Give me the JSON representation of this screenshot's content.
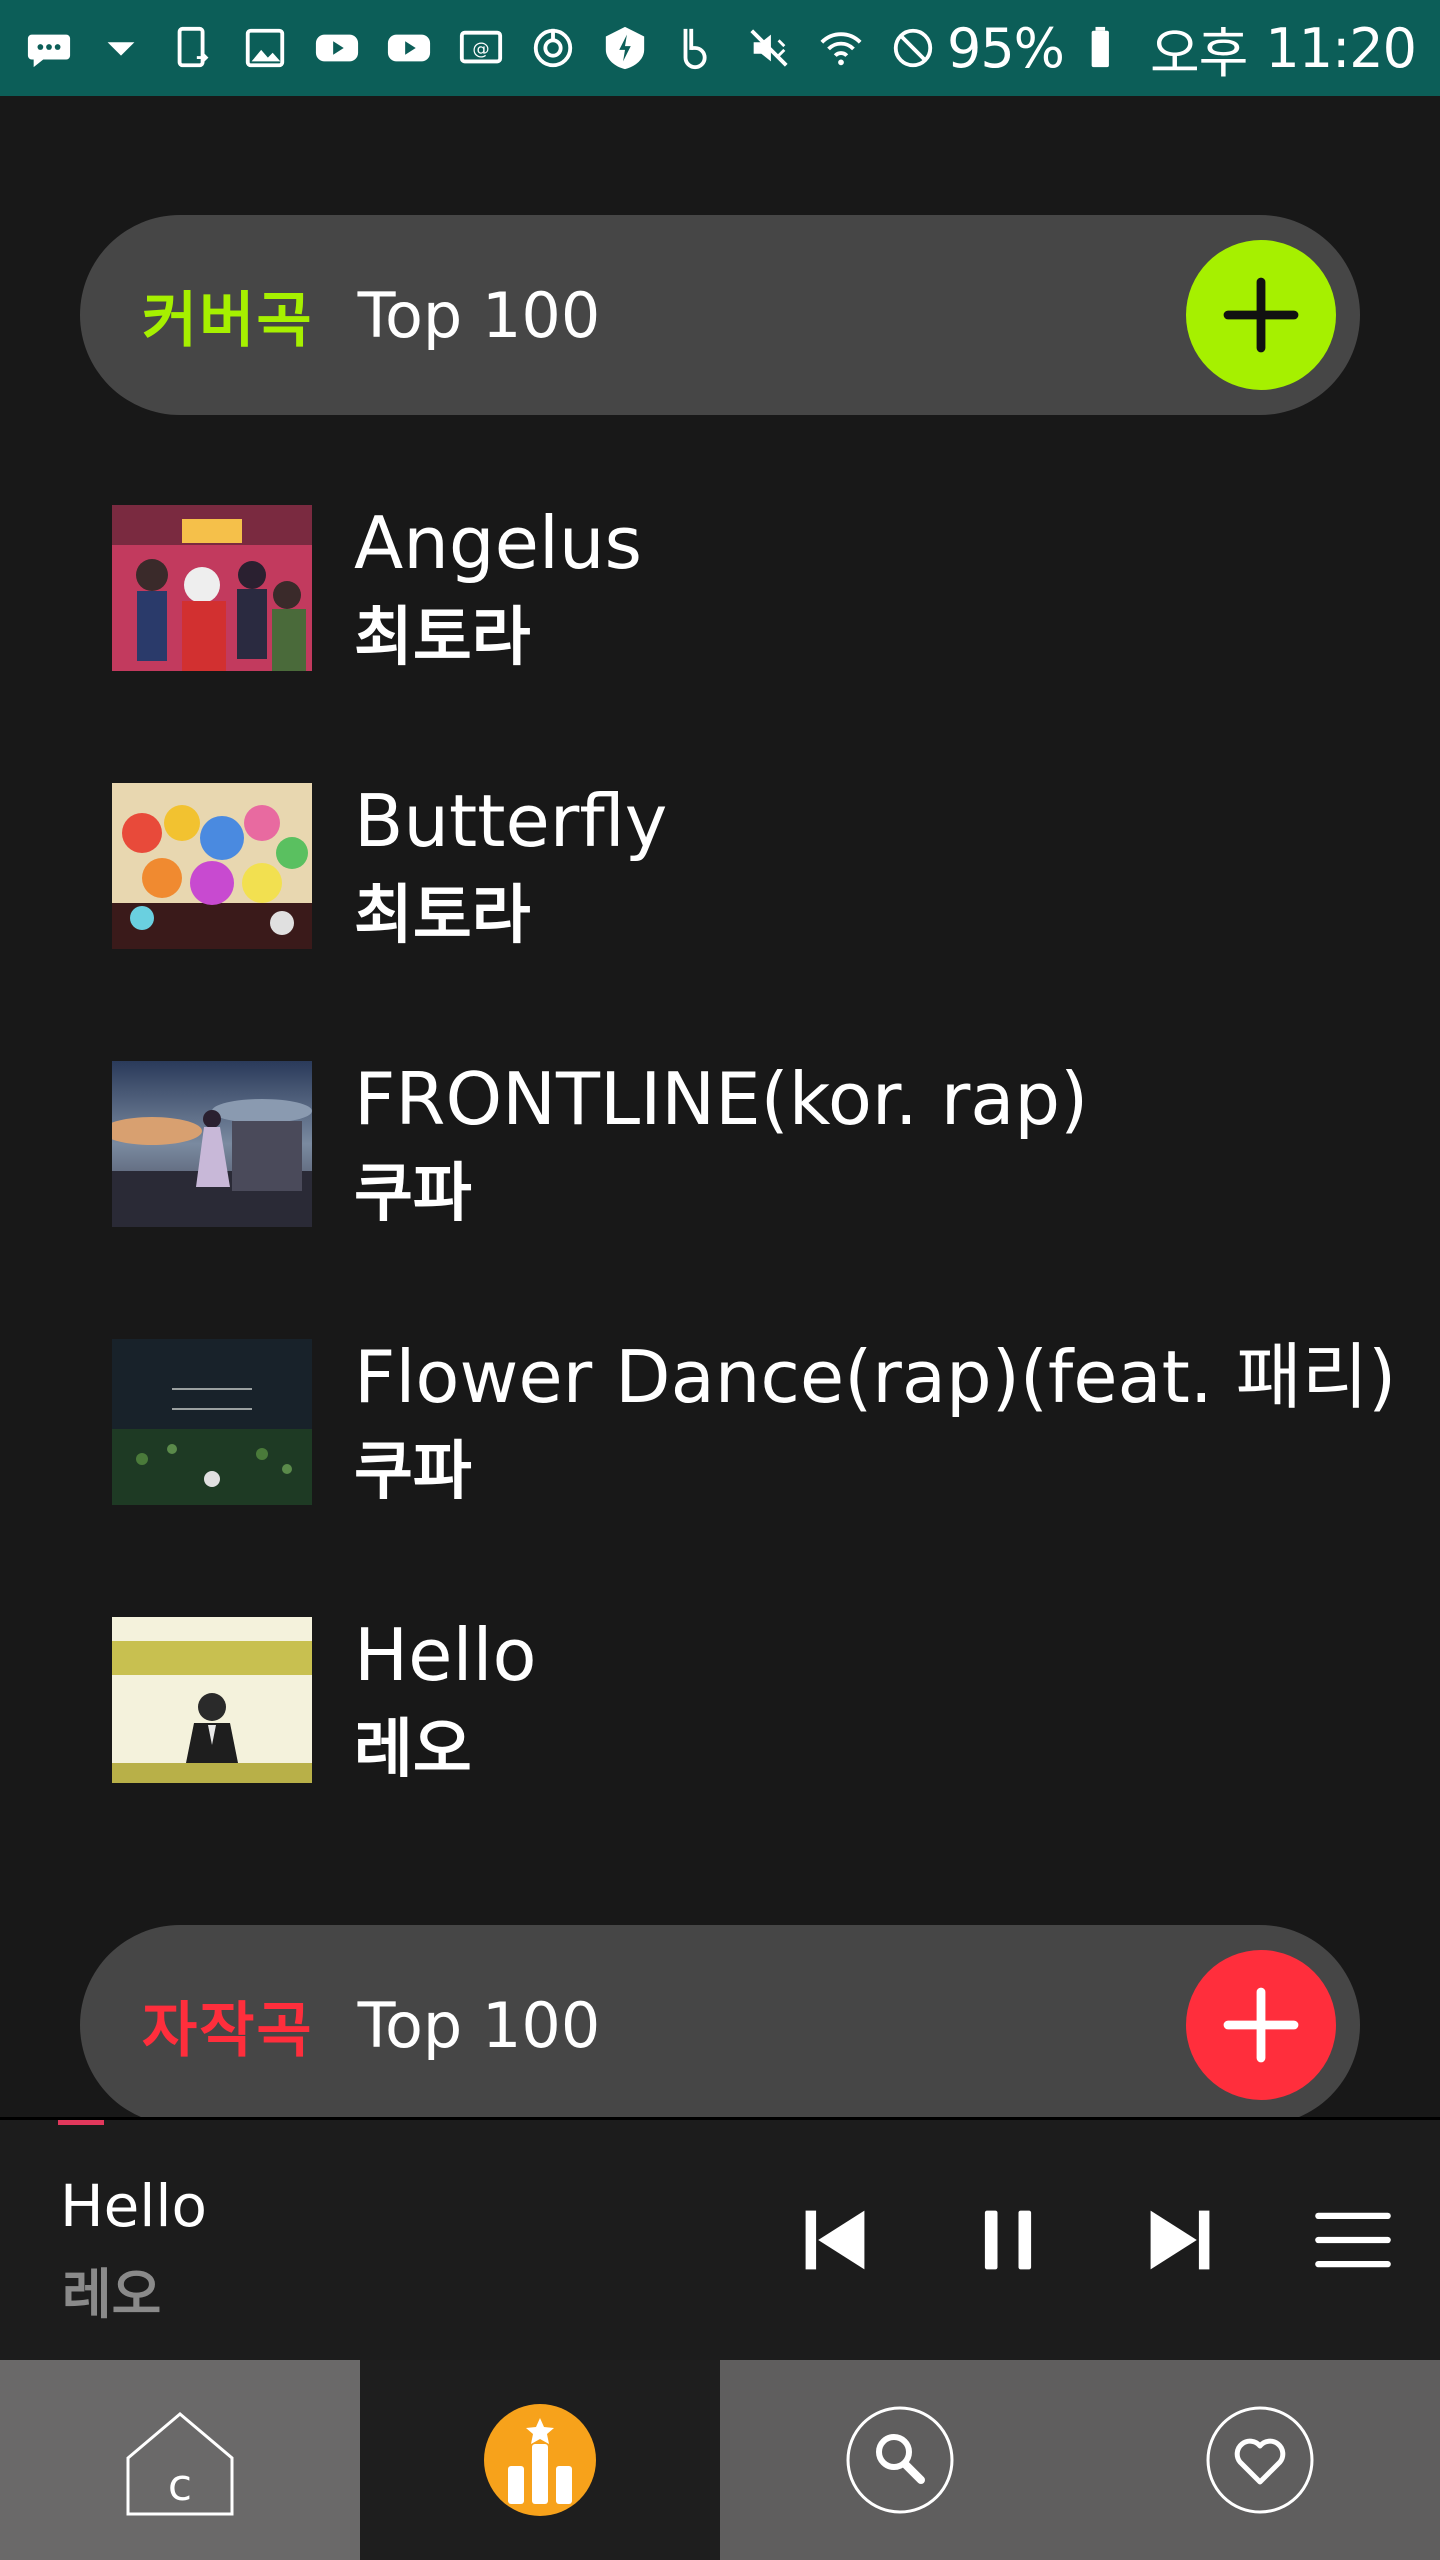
{
  "status_bar": {
    "battery_text": "95%",
    "ampm": "오후",
    "time": "11:20",
    "icons": [
      "chat-icon",
      "dropdown-icon",
      "phone-sync-icon",
      "image-icon",
      "youtube-icon",
      "youtube-icon",
      "cast-icon",
      "power-saving-icon",
      "shield-icon",
      "b-app-icon",
      "mute-icon",
      "wifi-icon",
      "no-disturb-icon",
      "battery-icon"
    ]
  },
  "cover_section": {
    "tag": "커버곡",
    "title": "Top 100",
    "tag_color": "#a6f000",
    "button_color": "#a6f000"
  },
  "songs": [
    {
      "title": "Angelus",
      "artist": "최토라"
    },
    {
      "title": "Butterfly",
      "artist": "최토라"
    },
    {
      "title": "FRONTLINE(kor. rap)",
      "artist": "쿠파"
    },
    {
      "title": "Flower Dance(rap)(feat. 패리)",
      "artist": "쿠파"
    },
    {
      "title": "Hello",
      "artist": "레오"
    }
  ],
  "original_section": {
    "tag": "자작곡",
    "title": "Top 100",
    "tag_color": "#ff2e3c",
    "button_color": "#ff2e3c"
  },
  "now_playing": {
    "title": "Hello",
    "artist": "레오",
    "progress_color": "#e2385c"
  },
  "player_controls": [
    "previous-icon",
    "pause-icon",
    "next-icon",
    "menu-icon"
  ],
  "bottom_nav": {
    "tabs": [
      "home-tab",
      "chart-tab",
      "search-tab",
      "favorites-tab"
    ],
    "active_color": "#f7a21b"
  }
}
